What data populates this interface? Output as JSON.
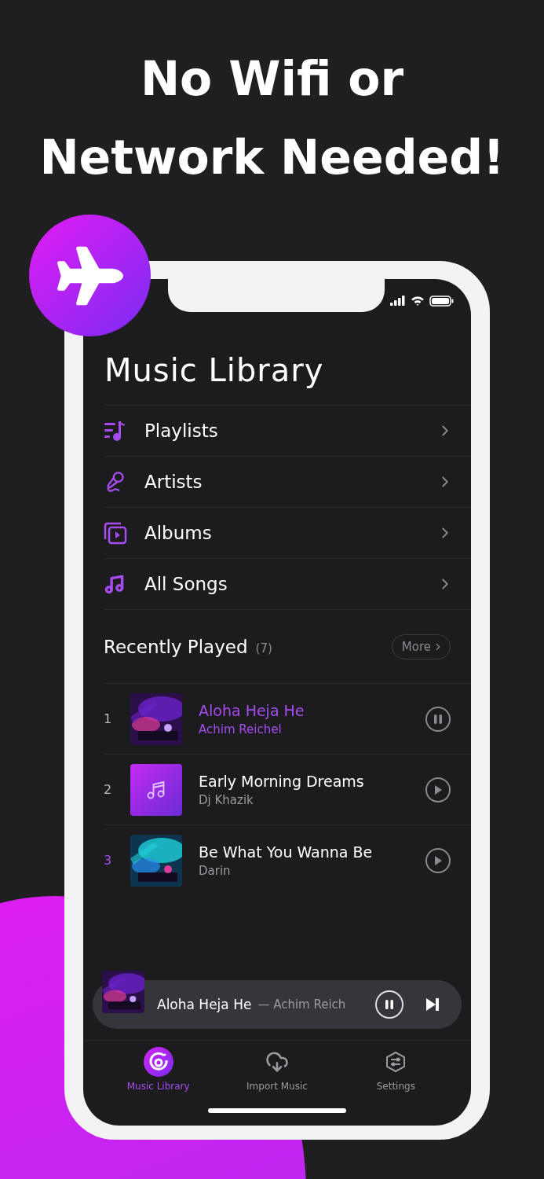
{
  "headline": [
    "No Wifi or",
    "Network Needed!"
  ],
  "screen": {
    "title": "Music Library",
    "menu": [
      {
        "kind": "playlists",
        "label": "Playlists"
      },
      {
        "kind": "artists",
        "label": "Artists"
      },
      {
        "kind": "albums",
        "label": "Albums"
      },
      {
        "kind": "songs",
        "label": "All Songs"
      }
    ],
    "recent": {
      "title": "Recently Played",
      "count": "(7)",
      "more": "More",
      "tracks": [
        {
          "number": "1",
          "accent_number": false,
          "title": "Aloha Heja He",
          "artist": "Achim Reichel",
          "playing": true
        },
        {
          "number": "2",
          "accent_number": false,
          "art": {
            "kind": "placeholder"
          },
          "title": "Early Morning Dreams",
          "artist": "Dj Khazik",
          "playing": false
        },
        {
          "number": "3",
          "accent_number": true,
          "title": "Be What You Wanna Be",
          "artist": "Darin",
          "playing": false
        }
      ]
    },
    "mini_player": {
      "title": "Aloha Heja He",
      "artist": "— Achim Reich",
      "playing": true
    },
    "tabs": [
      {
        "kind": "library",
        "label": "Music Library",
        "selected": true
      },
      {
        "kind": "import",
        "label": "Import Music",
        "selected": false
      },
      {
        "kind": "settings",
        "label": "Settings",
        "selected": false
      }
    ]
  }
}
